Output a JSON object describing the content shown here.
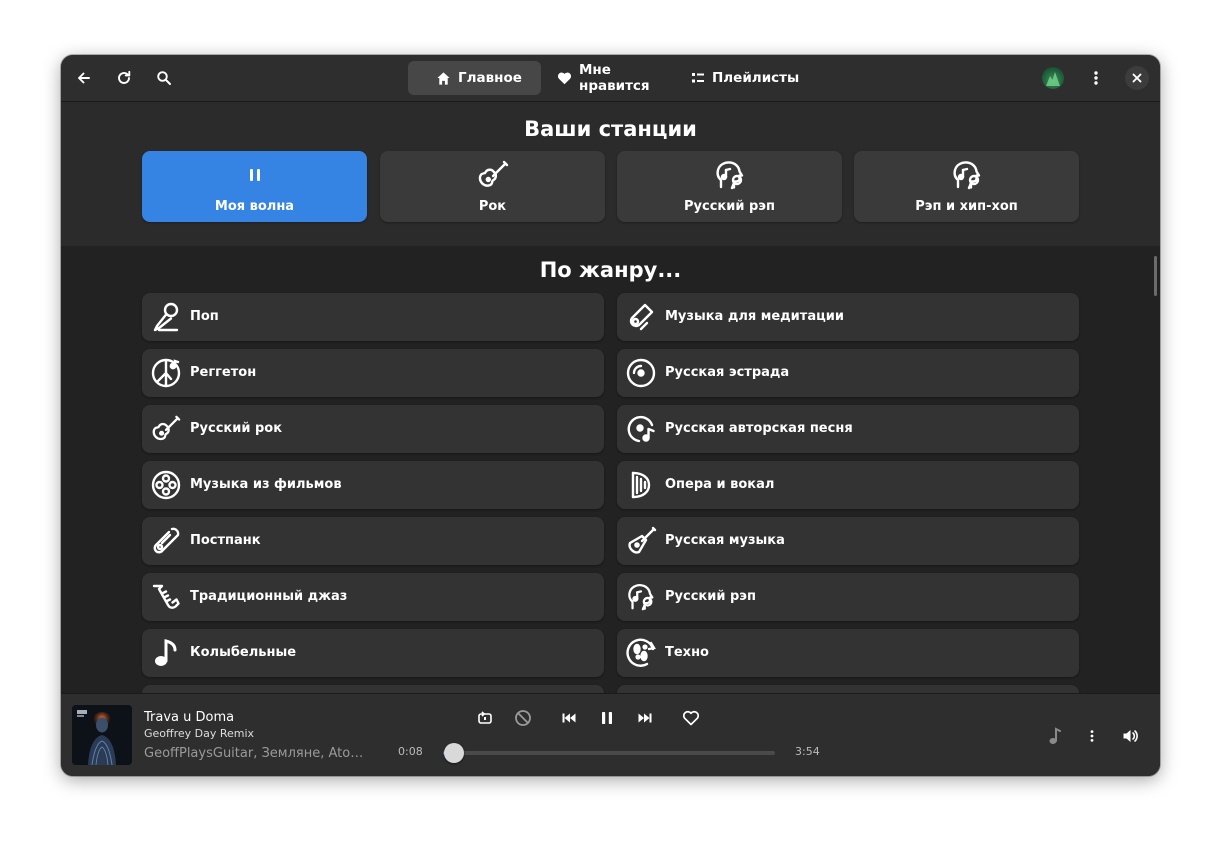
{
  "header": {
    "tabs": [
      {
        "label": "Главное",
        "icon": "home-icon",
        "active": true
      },
      {
        "label": "Мне нравится",
        "icon": "heart-icon",
        "active": false
      },
      {
        "label": "Плейлисты",
        "icon": "playlist-icon",
        "active": false
      }
    ]
  },
  "stations": {
    "title": "Ваши станции",
    "items": [
      {
        "label": "Моя волна",
        "icon": "pause-icon",
        "active": true
      },
      {
        "label": "Рок",
        "icon": "guitar-icon",
        "active": false
      },
      {
        "label": "Русский рэп",
        "icon": "rap-head-icon",
        "active": false
      },
      {
        "label": "Рэп и хип-хоп",
        "icon": "rap-head-icon",
        "active": false
      }
    ]
  },
  "genres": {
    "title": "По жанру...",
    "items": [
      {
        "label": "Поп",
        "icon": "microphone-icon"
      },
      {
        "label": "Музыка для медитации",
        "icon": "meditation-icon"
      },
      {
        "label": "Реггетон",
        "icon": "peace-icon"
      },
      {
        "label": "Русская эстрада",
        "icon": "vinyl-icon"
      },
      {
        "label": "Русский рок",
        "icon": "guitar-icon"
      },
      {
        "label": "Русская авторская песня",
        "icon": "disc-note-icon"
      },
      {
        "label": "Музыка из фильмов",
        "icon": "film-reel-icon"
      },
      {
        "label": "Опера и вокал",
        "icon": "harp-icon"
      },
      {
        "label": "Постпанк",
        "icon": "safety-pin-icon"
      },
      {
        "label": "Русская музыка",
        "icon": "balalaika-icon"
      },
      {
        "label": "Традиционный джаз",
        "icon": "saxophone-icon"
      },
      {
        "label": "Русский рэп",
        "icon": "rap-head-icon"
      },
      {
        "label": "Колыбельные",
        "icon": "music-note-icon"
      },
      {
        "label": "Техно",
        "icon": "techno-icon"
      }
    ]
  },
  "player": {
    "title": "Trava u Doma",
    "subtitle": "Geoffrey Day Remix",
    "artists": "GeoffPlaysGuitar, Земляне, Atomic Heart",
    "current_time": "0:08",
    "total_time": "3:54",
    "progress": 0.034
  },
  "colors": {
    "accent": "#3584e4",
    "window_bg": "#222222",
    "card_bg": "#333333",
    "header_bg": "#2e2e2e"
  }
}
